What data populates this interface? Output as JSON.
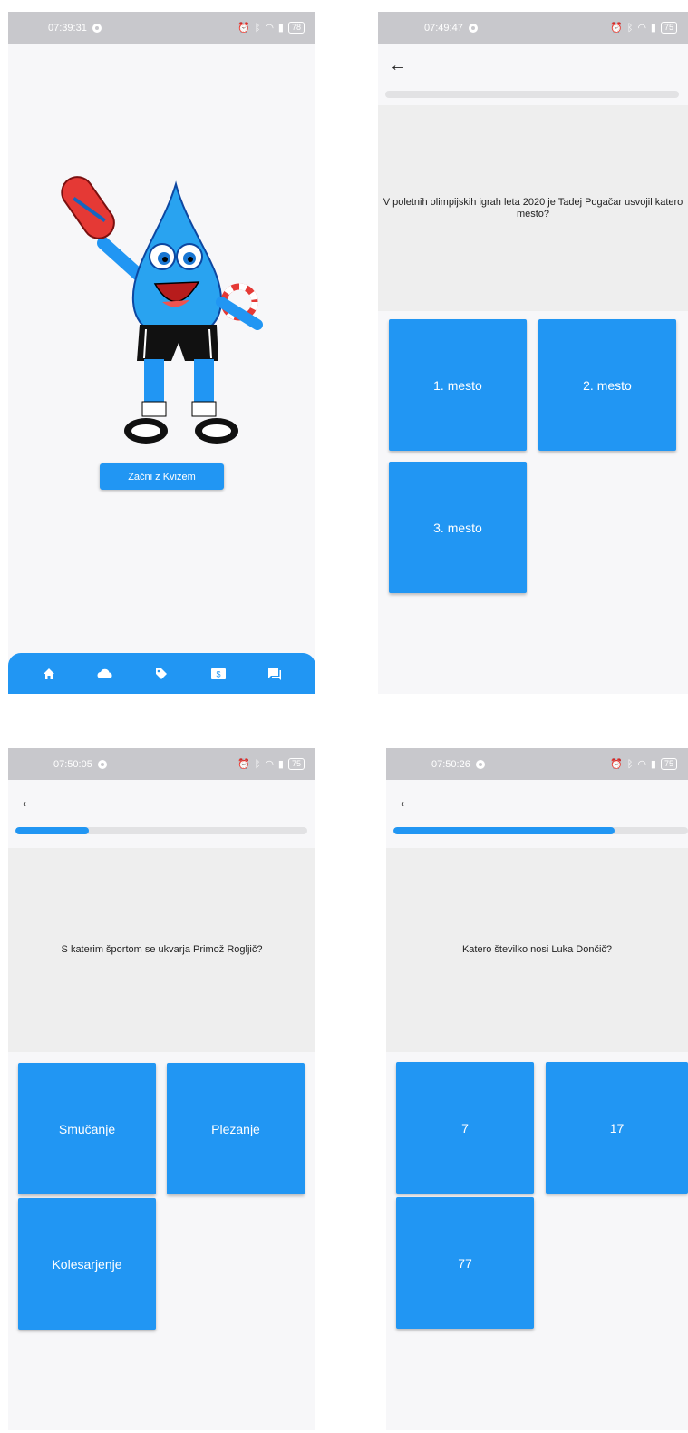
{
  "screens": [
    {
      "status": {
        "time": "07:39:31",
        "battery": "78"
      },
      "start_button": "Začni z Kvizem",
      "nav": [
        "home-icon",
        "cloud-icon",
        "tag-icon",
        "money-icon",
        "chat-icon"
      ]
    },
    {
      "status": {
        "time": "07:49:47",
        "battery": "75"
      },
      "progress": 0.0,
      "question": "V poletnih olimpijskih igrah leta 2020 je Tadej Pogačar usvojil katero mesto?",
      "answers": [
        "1. mesto",
        "2. mesto",
        "3. mesto"
      ]
    },
    {
      "status": {
        "time": "07:50:05",
        "battery": "75"
      },
      "progress": 0.25,
      "question": "S katerim športom se ukvarja Primož Rogljič?",
      "answers": [
        "Smučanje",
        "Plezanje",
        "Kolesarjenje"
      ]
    },
    {
      "status": {
        "time": "07:50:26",
        "battery": "75"
      },
      "progress": 0.75,
      "question": "Katero številko nosi Luka Dončič?",
      "answers": [
        "7",
        "17",
        "77"
      ]
    }
  ],
  "colors": {
    "accent": "#2196f3",
    "panel": "#eeeeee",
    "statusbar": "#c8c8cc"
  }
}
